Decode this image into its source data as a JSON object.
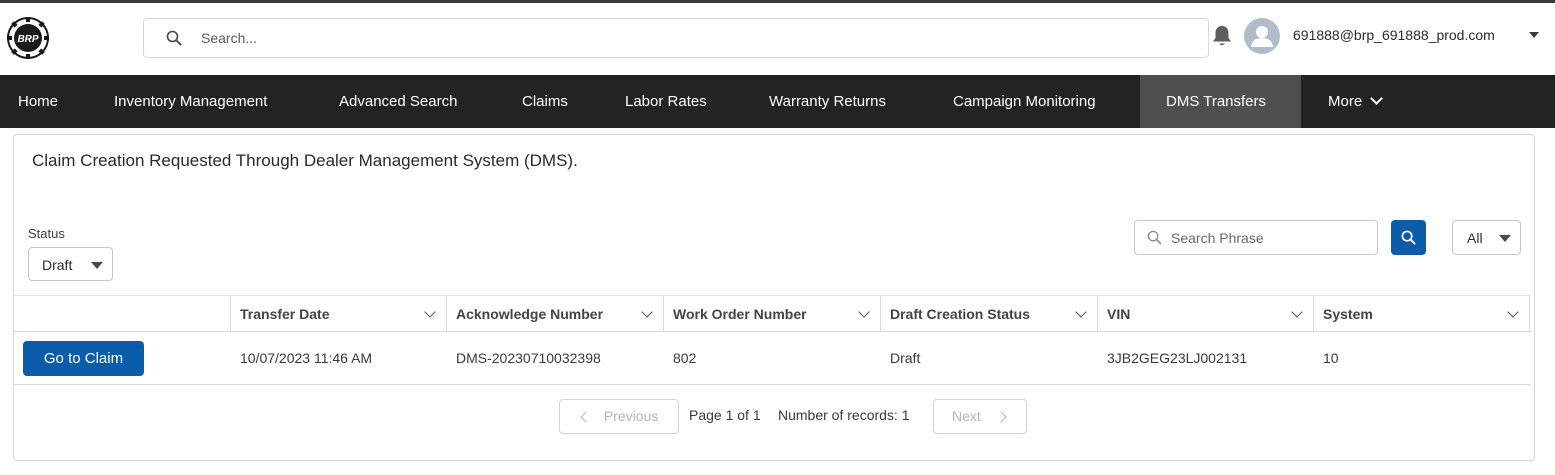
{
  "header": {
    "logo_text": "BRP",
    "search_placeholder": "Search...",
    "user_email": "691888@brp_691888_prod.com"
  },
  "nav": {
    "items": [
      {
        "label": "Home"
      },
      {
        "label": "Inventory Management"
      },
      {
        "label": "Advanced Search"
      },
      {
        "label": "Claims"
      },
      {
        "label": "Labor Rates"
      },
      {
        "label": "Warranty Returns"
      },
      {
        "label": "Campaign Monitoring"
      },
      {
        "label": "DMS Transfers",
        "active": true
      },
      {
        "label": "More"
      }
    ]
  },
  "page": {
    "title": "Claim Creation Requested Through Dealer Management System (DMS).",
    "status_label": "Status",
    "status_value": "Draft",
    "search_placeholder": "Search Phrase",
    "filter_value": "All"
  },
  "table": {
    "columns": [
      "Transfer Date",
      "Acknowledge Number",
      "Work Order Number",
      "Draft Creation Status",
      "VIN",
      "System"
    ],
    "rows": [
      {
        "action": "Go to Claim",
        "transfer_date": "10/07/2023 11:46 AM",
        "acknowledge_number": "DMS-20230710032398",
        "work_order_number": "802",
        "draft_creation_status": "Draft",
        "vin": "3JB2GEG23LJ002131",
        "system": "10"
      }
    ]
  },
  "pagination": {
    "previous_label": "Previous",
    "page_info": "Page 1 of 1",
    "records_info": "Number of records: 1",
    "next_label": "Next"
  },
  "colors": {
    "nav_bg": "#232323",
    "nav_active": "#4f4f4f",
    "brand_blue": "#0b5cab"
  }
}
